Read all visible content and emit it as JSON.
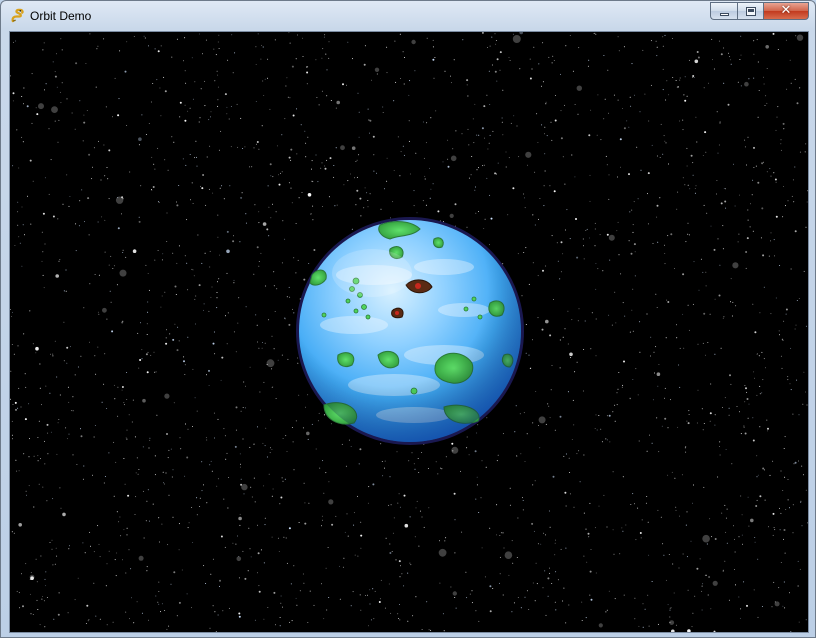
{
  "window": {
    "title": "Orbit Demo",
    "controls": {
      "minimize": "minimize",
      "maximize": "maximize",
      "close": "close",
      "close_glyph": "✕"
    }
  },
  "icons": {
    "app": "python-snake-icon"
  },
  "scene": {
    "background": "starfield",
    "planet": "blue-green-planet",
    "colors": {
      "space": "#000000",
      "ocean": "#3fa9f5",
      "ocean_light": "#bfe6ff",
      "land": "#3cc24a",
      "planet_outline": "#1a1850"
    }
  }
}
